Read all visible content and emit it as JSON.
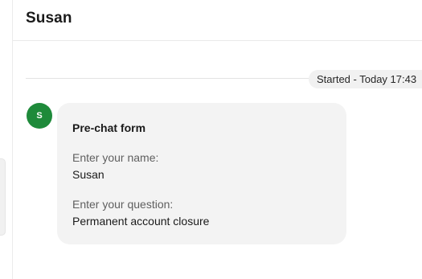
{
  "header": {
    "title": "Susan"
  },
  "timeline": {
    "started_label": "Started - Today 17:43"
  },
  "message": {
    "avatar_initial": "S",
    "avatar_color": "#1e8a3a",
    "form_title": "Pre-chat form",
    "fields": [
      {
        "label": "Enter your name:",
        "value": "Susan"
      },
      {
        "label": "Enter your question:",
        "value": "Permanent account closure"
      }
    ]
  }
}
